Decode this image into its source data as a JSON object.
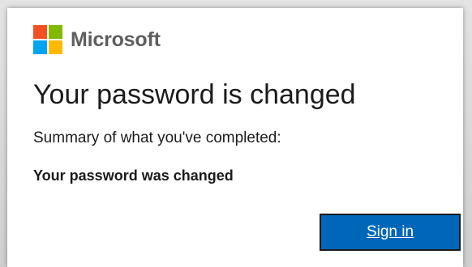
{
  "brand": {
    "name": "Microsoft",
    "logo_colors": [
      "#f25022",
      "#7fba00",
      "#00a4ef",
      "#ffb900"
    ]
  },
  "title": "Your password is changed",
  "summary_label": "Summary of what you've completed:",
  "result_text": "Your password was changed",
  "signin_button": {
    "label": "Sign in",
    "color": "#0067b8"
  }
}
